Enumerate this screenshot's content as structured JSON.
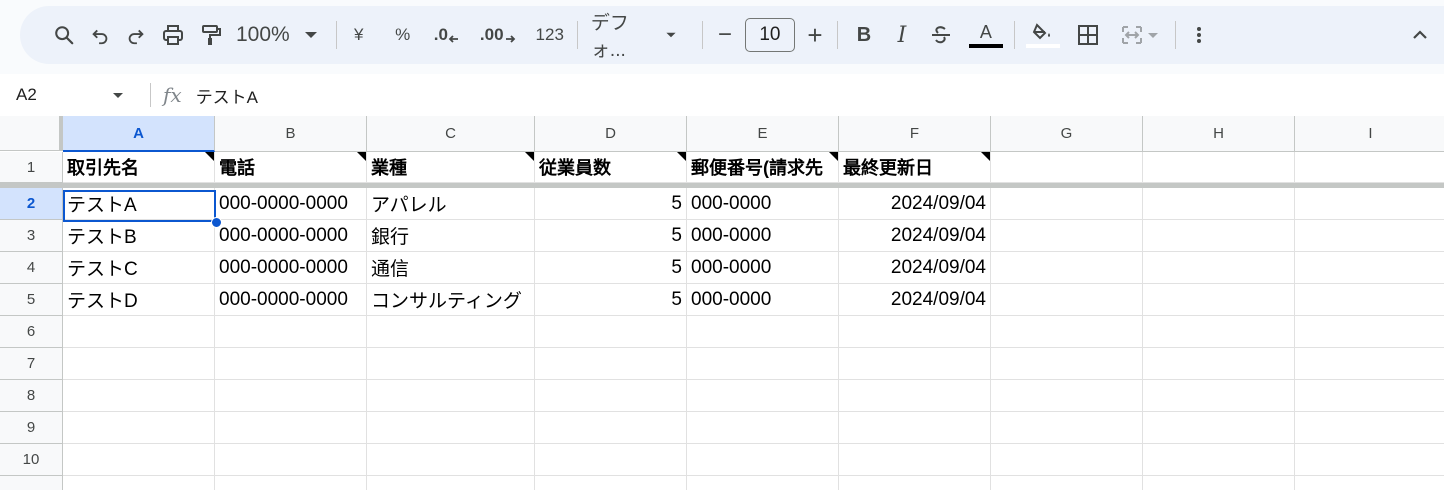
{
  "toolbar": {
    "zoom": "100%",
    "currency": "¥",
    "percent": "%",
    "dec_decrease": ".0",
    "dec_increase": ".00",
    "number_format": "123",
    "font": "デフォ...",
    "font_size": "10",
    "minus": "−",
    "plus": "+",
    "bold": "B",
    "italic": "I",
    "text_color_glyph": "A",
    "text_color": "#000000"
  },
  "formula_bar": {
    "name_box": "A2",
    "content": "テストA"
  },
  "columns": [
    "A",
    "B",
    "C",
    "D",
    "E",
    "F",
    "G",
    "H",
    "I"
  ],
  "rows": [
    "1",
    "2",
    "3",
    "4",
    "5",
    "6",
    "7",
    "8",
    "9",
    "10"
  ],
  "header_row": [
    "取引先名",
    "電話",
    "業種",
    "従業員数",
    "郵便番号(請求先",
    "最終更新日"
  ],
  "data_rows": [
    [
      "テストA",
      "000-0000-0000",
      "アパレル",
      "5",
      "000-0000",
      "2024/09/04"
    ],
    [
      "テストB",
      "000-0000-0000",
      "銀行",
      "5",
      "000-0000",
      "2024/09/04"
    ],
    [
      "テストC",
      "000-0000-0000",
      "通信",
      "5",
      "000-0000",
      "2024/09/04"
    ],
    [
      "テストD",
      "000-0000-0000",
      "コンサルティング",
      "5",
      "000-0000",
      "2024/09/04"
    ]
  ],
  "selected_cell": "A2",
  "colors": {
    "accent": "#0b57d0",
    "selected_header": "#d3e3fd",
    "toolbar_bg": "#edf2fa"
  }
}
